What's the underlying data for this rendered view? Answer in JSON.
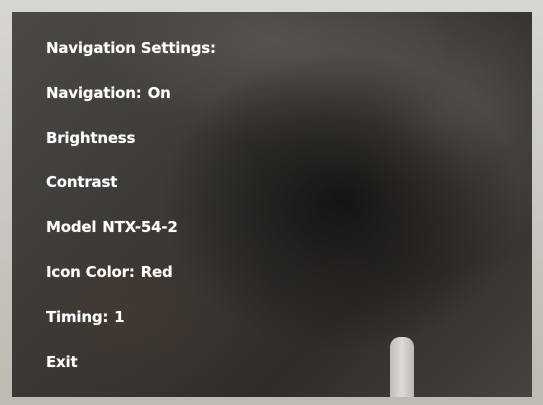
{
  "menu": {
    "title": "Navigation Settings:",
    "items": [
      {
        "label": "Navigation:",
        "value": "On"
      },
      {
        "label": "Brightness",
        "value": ""
      },
      {
        "label": "Contrast",
        "value": ""
      },
      {
        "label": "Model",
        "value": "NTX-54-2"
      },
      {
        "label": "Icon Color:",
        "value": "Red"
      },
      {
        "label": "Timing:",
        "value": "1"
      },
      {
        "label": "Exit",
        "value": ""
      }
    ]
  },
  "colors": {
    "text": "#ffffff",
    "screen_background": "#3b3835",
    "bezel": "#c9c6c0"
  }
}
